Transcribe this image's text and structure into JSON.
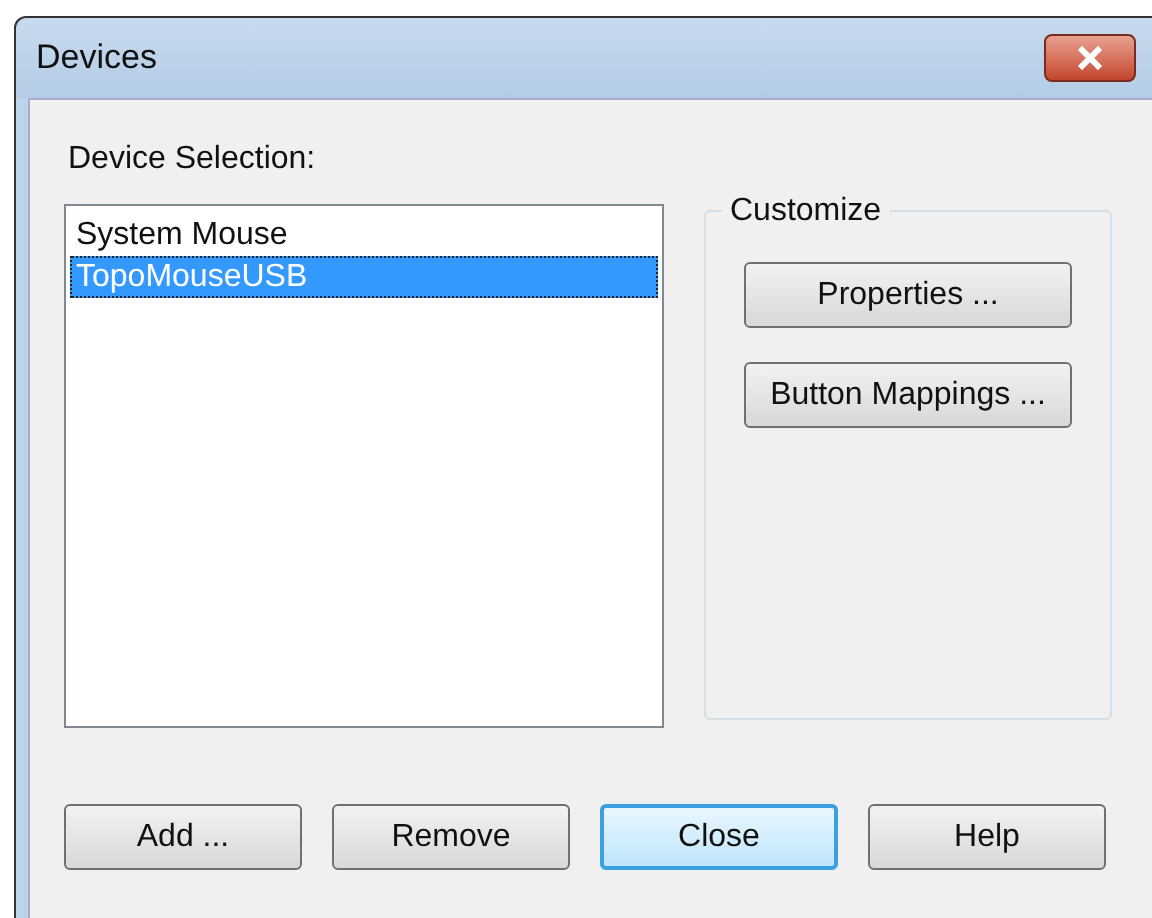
{
  "window": {
    "title": "Devices"
  },
  "device_selection": {
    "label": "Device Selection:",
    "items": [
      {
        "label": "System Mouse",
        "selected": false
      },
      {
        "label": "TopoMouseUSB",
        "selected": true
      }
    ]
  },
  "customize": {
    "title": "Customize",
    "buttons": [
      "Properties ...",
      "Button Mappings ..."
    ]
  },
  "buttons": [
    {
      "label": "Add ...",
      "default": false
    },
    {
      "label": "Remove",
      "default": false
    },
    {
      "label": "Close",
      "default": true
    },
    {
      "label": "Help",
      "default": false
    }
  ]
}
